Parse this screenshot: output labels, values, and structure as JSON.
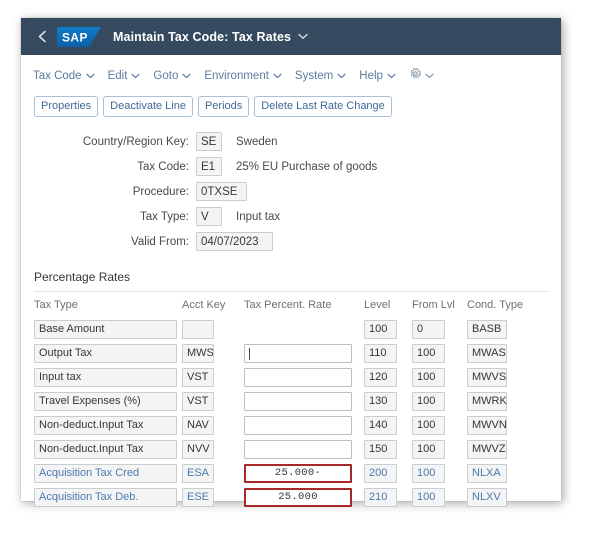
{
  "shellbar": {
    "back_icon": "chevron-left-icon",
    "logo": "sap-logo",
    "logo_text": "SAP",
    "title": "Maintain Tax Code: Tax Rates",
    "title_caret_icon": "chevron-down-icon",
    "bg_color": "#354a5f"
  },
  "menubar": {
    "items": [
      {
        "label": "Tax Code"
      },
      {
        "label": "Edit"
      },
      {
        "label": "Goto"
      },
      {
        "label": "Environment"
      },
      {
        "label": "System"
      },
      {
        "label": "Help"
      }
    ],
    "settings_icon": "gear-icon",
    "link_color": "#5a7b9e"
  },
  "toolbar": {
    "buttons": [
      {
        "label": "Properties"
      },
      {
        "label": "Deactivate Line"
      },
      {
        "label": "Periods"
      },
      {
        "label": "Delete Last Rate Change"
      }
    ]
  },
  "form": {
    "fields": [
      {
        "label": "Country/Region Key:",
        "value": "SE",
        "description": "Sweden",
        "size": "sm"
      },
      {
        "label": "Tax Code:",
        "value": "E1",
        "description": "25% EU Purchase of goods",
        "size": "sm"
      },
      {
        "label": "Procedure:",
        "value": "0TXSE",
        "description": "",
        "size": "md"
      },
      {
        "label": "Tax Type:",
        "value": "V",
        "description": "Input tax",
        "size": "sm"
      },
      {
        "label": "Valid From:",
        "value": "04/07/2023",
        "description": "",
        "size": "lg"
      }
    ]
  },
  "section": {
    "title": "Percentage Rates"
  },
  "table": {
    "columns": [
      {
        "label": "Tax Type"
      },
      {
        "label": "Acct Key"
      },
      {
        "label": "Tax Percent. Rate"
      },
      {
        "label": "Level"
      },
      {
        "label": "From Lvl"
      },
      {
        "label": "Cond. Type"
      }
    ],
    "error_border_color": "#a52929",
    "link_color": "#4a7ab0",
    "rows": [
      {
        "tax_type": "Base Amount",
        "acct_key": "",
        "rate": "",
        "rate_state": "none",
        "level": "100",
        "from_lvl": "0",
        "cond_type": "BASB",
        "highlight": false
      },
      {
        "tax_type": "Output Tax",
        "acct_key": "MWS",
        "rate": "",
        "rate_state": "focused",
        "level": "110",
        "from_lvl": "100",
        "cond_type": "MWAS",
        "highlight": false
      },
      {
        "tax_type": "Input tax",
        "acct_key": "VST",
        "rate": "",
        "rate_state": "normal",
        "level": "120",
        "from_lvl": "100",
        "cond_type": "MWVS",
        "highlight": false
      },
      {
        "tax_type": "Travel Expenses (%)",
        "acct_key": "VST",
        "rate": "",
        "rate_state": "normal",
        "level": "130",
        "from_lvl": "100",
        "cond_type": "MWRK",
        "highlight": false
      },
      {
        "tax_type": "Non-deduct.Input Tax",
        "acct_key": "NAV",
        "rate": "",
        "rate_state": "normal",
        "level": "140",
        "from_lvl": "100",
        "cond_type": "MWVN",
        "highlight": false
      },
      {
        "tax_type": "Non-deduct.Input Tax",
        "acct_key": "NVV",
        "rate": "",
        "rate_state": "normal",
        "level": "150",
        "from_lvl": "100",
        "cond_type": "MWVZ",
        "highlight": false
      },
      {
        "tax_type": "Acquisition Tax Cred",
        "acct_key": "ESA",
        "rate": "25.000-",
        "rate_state": "error",
        "level": "200",
        "from_lvl": "100",
        "cond_type": "NLXA",
        "highlight": true
      },
      {
        "tax_type": "Acquisition Tax Deb.",
        "acct_key": "ESE",
        "rate": "25.000",
        "rate_state": "error",
        "level": "210",
        "from_lvl": "100",
        "cond_type": "NLXV",
        "highlight": true
      }
    ]
  }
}
